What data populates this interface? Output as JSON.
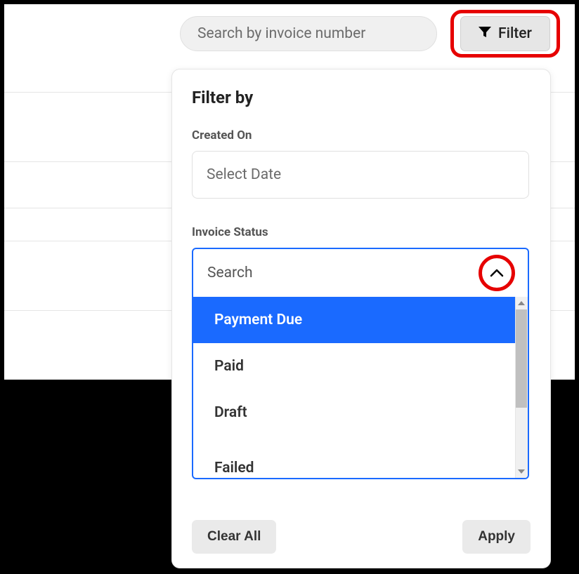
{
  "search": {
    "placeholder": "Search by invoice number"
  },
  "filterButton": {
    "label": "Filter"
  },
  "filterPanel": {
    "title": "Filter by",
    "createdOn": {
      "label": "Created On",
      "placeholder": "Select Date"
    },
    "invoiceStatus": {
      "label": "Invoice Status",
      "searchPlaceholder": "Search",
      "options": [
        "Payment Due",
        "Paid",
        "Draft",
        "Failed"
      ],
      "selectedIndex": 0
    },
    "clearAll": "Clear All",
    "apply": "Apply"
  }
}
